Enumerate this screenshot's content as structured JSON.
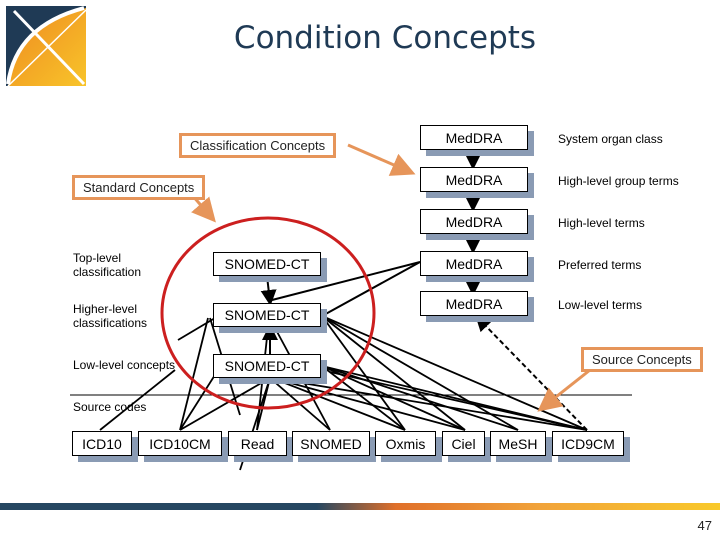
{
  "title": "Condition Concepts",
  "logo": {
    "icon": "ohdsi-logo-icon",
    "colors": {
      "navy": "#1f3a55",
      "orange": "#f0a030"
    }
  },
  "callouts": {
    "classification": "Classification Concepts",
    "standard": "Standard Concepts",
    "source": "Source Concepts"
  },
  "level_labels": {
    "top": "Top-level classification",
    "higher": "Higher-level classifications",
    "low": "Low-level concepts",
    "source_codes": "Source codes"
  },
  "snomed_nodes": [
    "SNOMED-CT",
    "SNOMED-CT",
    "SNOMED-CT"
  ],
  "meddra_nodes": [
    {
      "label": "MedDRA",
      "level": "System organ class"
    },
    {
      "label": "MedDRA",
      "level": "High-level group terms"
    },
    {
      "label": "MedDRA",
      "level": "High-level terms"
    },
    {
      "label": "MedDRA",
      "level": "Preferred terms"
    },
    {
      "label": "MedDRA",
      "level": "Low-level terms"
    }
  ],
  "source_nodes": [
    "ICD10",
    "ICD10CM",
    "Read",
    "SNOMED",
    "Oxmis",
    "Ciel",
    "MeSH",
    "ICD9CM"
  ],
  "colors": {
    "callout_border": "#e6955a",
    "circle": "#cc1f1f",
    "shadow": "#8a9bb4",
    "title": "#1f3a55"
  },
  "page_number": "47"
}
